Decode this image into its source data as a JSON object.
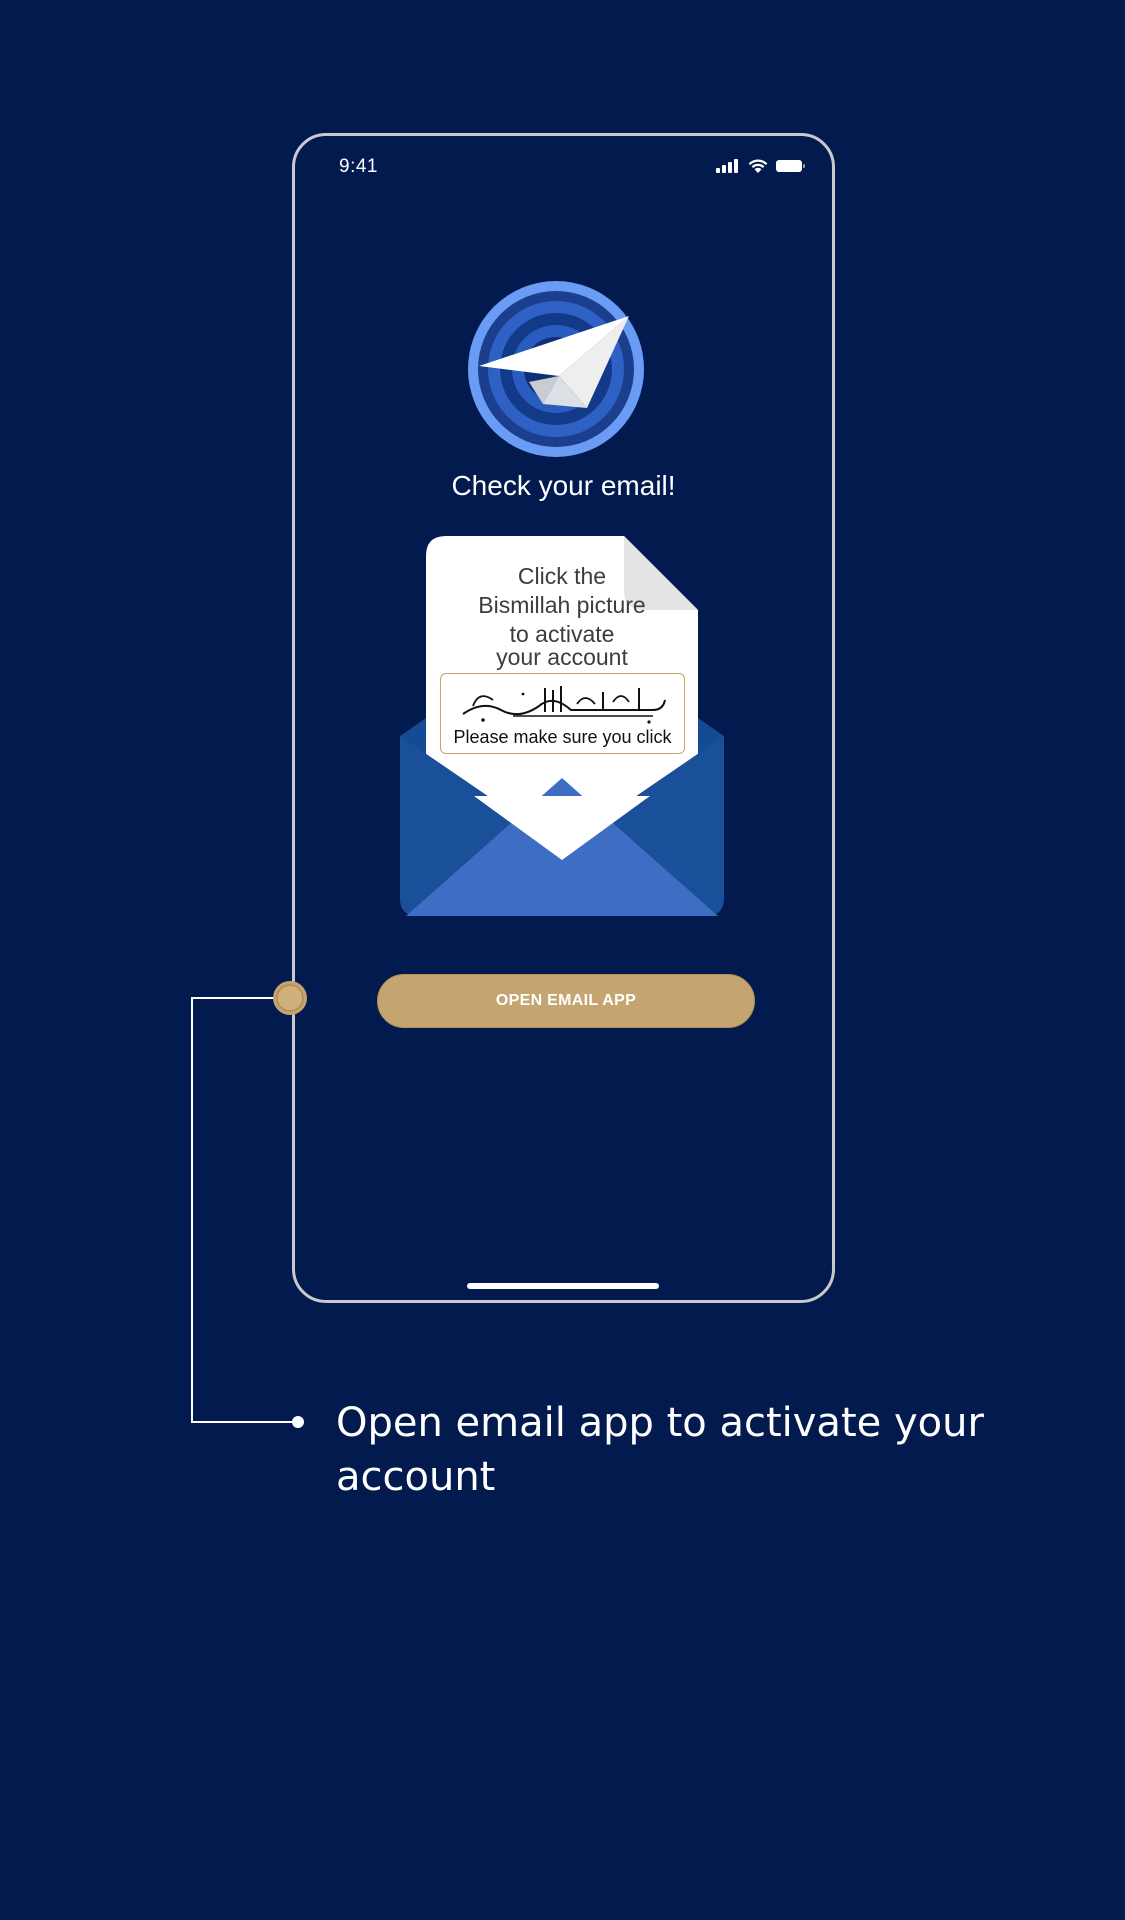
{
  "status_bar": {
    "time": "9:41",
    "icons": [
      "signal-icon",
      "wifi-icon",
      "battery-icon"
    ]
  },
  "screen": {
    "title": "Check your email!",
    "letter_lines": [
      "Click the",
      "Bismillah picture",
      "to activate",
      "your account"
    ],
    "bismillah_note": "Please make sure you click",
    "open_button_label": "OPEN EMAIL APP"
  },
  "annotation": {
    "caption": "Open email app to activate your account"
  },
  "colors": {
    "background": "#021a4e",
    "accent_gold": "#c4a56f",
    "logo_blue": "#5b8ff0",
    "envelope_blue": "#154b95"
  }
}
